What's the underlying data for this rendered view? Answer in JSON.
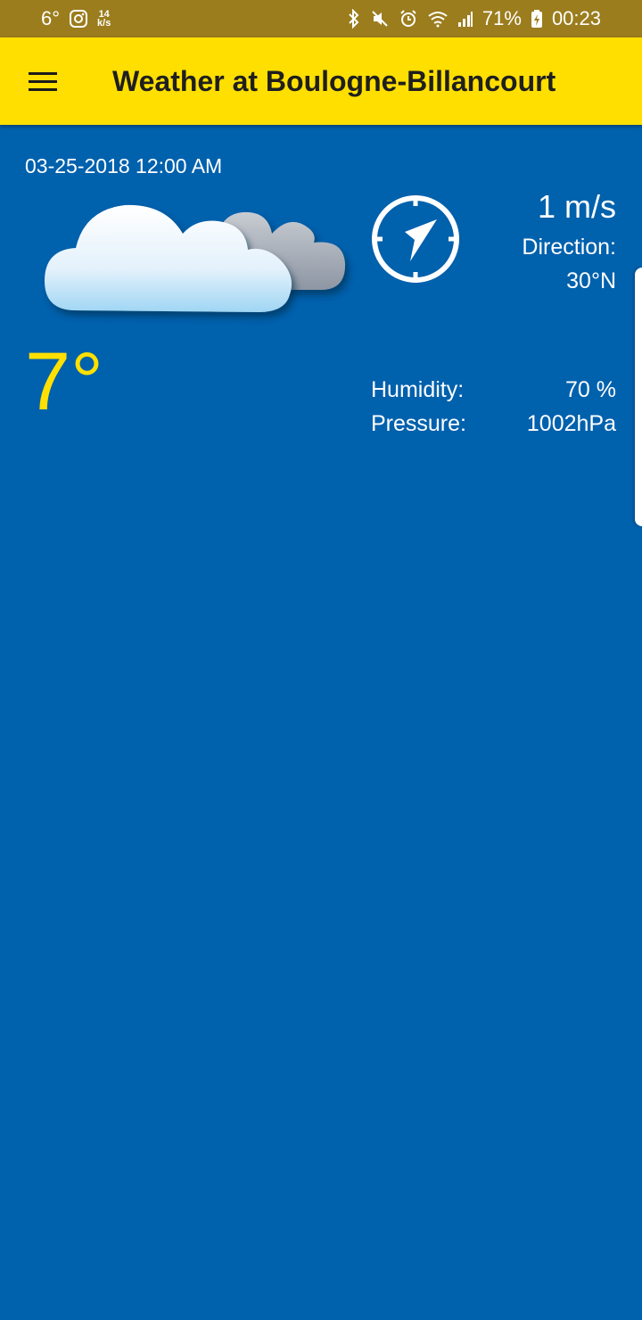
{
  "status_bar": {
    "temp": "6°",
    "speed_top": "14",
    "speed_bottom": "k/s",
    "battery": "71%",
    "time": "00:23",
    "icons": [
      "instagram-icon",
      "bluetooth-icon",
      "mute-icon",
      "alarm-icon",
      "wifi-icon",
      "signal-icon",
      "battery-charging-icon"
    ]
  },
  "app_bar": {
    "title": "Weather at Boulogne-Billancourt",
    "menu_icon": "menu-icon"
  },
  "weather": {
    "datetime": "03-25-2018 12:00 AM",
    "condition_icon": "clouds-icon",
    "temperature": "7°",
    "wind_speed": "1 m/s",
    "direction_label": "Direction:",
    "direction_value": "30°N",
    "compass_icon": "compass-icon",
    "humidity_label": "Humidity:",
    "humidity_value": "70 %",
    "pressure_label": "Pressure:",
    "pressure_value": "1002hPa"
  },
  "colors": {
    "status_bar": "#9b7d1e",
    "app_bar": "#ffdf00",
    "background": "#0061ad",
    "temperature": "#ffe000"
  }
}
